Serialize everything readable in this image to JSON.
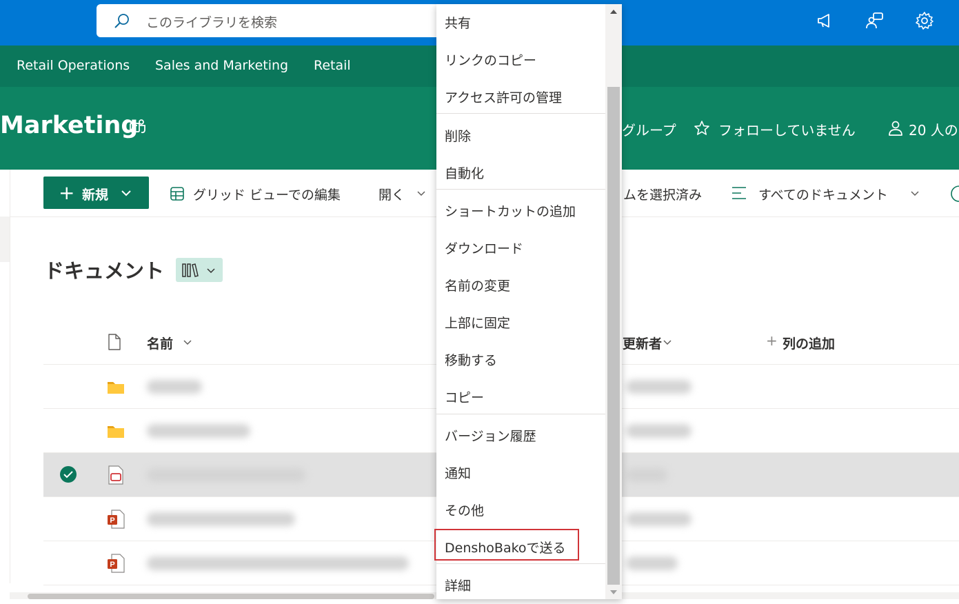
{
  "search": {
    "placeholder": "このライブラリを検索"
  },
  "hub_nav": [
    "Retail Operations",
    "Sales and Marketing",
    "Retail"
  ],
  "site": {
    "title": "Marketing",
    "group_label": "グループ",
    "follow_label": "フォローしていません",
    "members_label": "20 人の"
  },
  "command_bar": {
    "new_label": "新規",
    "grid_edit_label": "グリッド ビューでの編集",
    "open_label": "開く",
    "selected_label": "ムを選択済み",
    "view_label": "すべてのドキュメント"
  },
  "library": {
    "title": "ドキュメント",
    "columns": {
      "name": "名前",
      "modified_by": "更新者",
      "add_column": "列の追加"
    }
  },
  "context_menu": {
    "items": [
      "共有",
      "リンクのコピー",
      "アクセス許可の管理",
      "削除",
      "自動化",
      "ショートカットの追加",
      "ダウンロード",
      "名前の変更",
      "上部に固定",
      "移動する",
      "コピー",
      "バージョン履歴",
      "通知",
      "その他",
      "DenshoBakoで送る",
      "詳細"
    ]
  },
  "colors": {
    "suite_bar": "#0078d4",
    "hub_nav": "#0b775b",
    "site_header": "#0e8463",
    "accent": "#0b775b",
    "highlight_border": "#d13438"
  },
  "icons": {
    "search": "search-icon",
    "megaphone": "megaphone-icon",
    "feedback": "feedback-icon",
    "settings": "gear-icon",
    "teams": "teams-icon",
    "star": "star-icon",
    "person": "person-icon",
    "grid": "grid-icon",
    "view": "list-view-icon",
    "folder": "folder-icon",
    "pdf": "pdf-file-icon",
    "powerpoint": "powerpoint-icon",
    "check": "check-circle-icon"
  }
}
